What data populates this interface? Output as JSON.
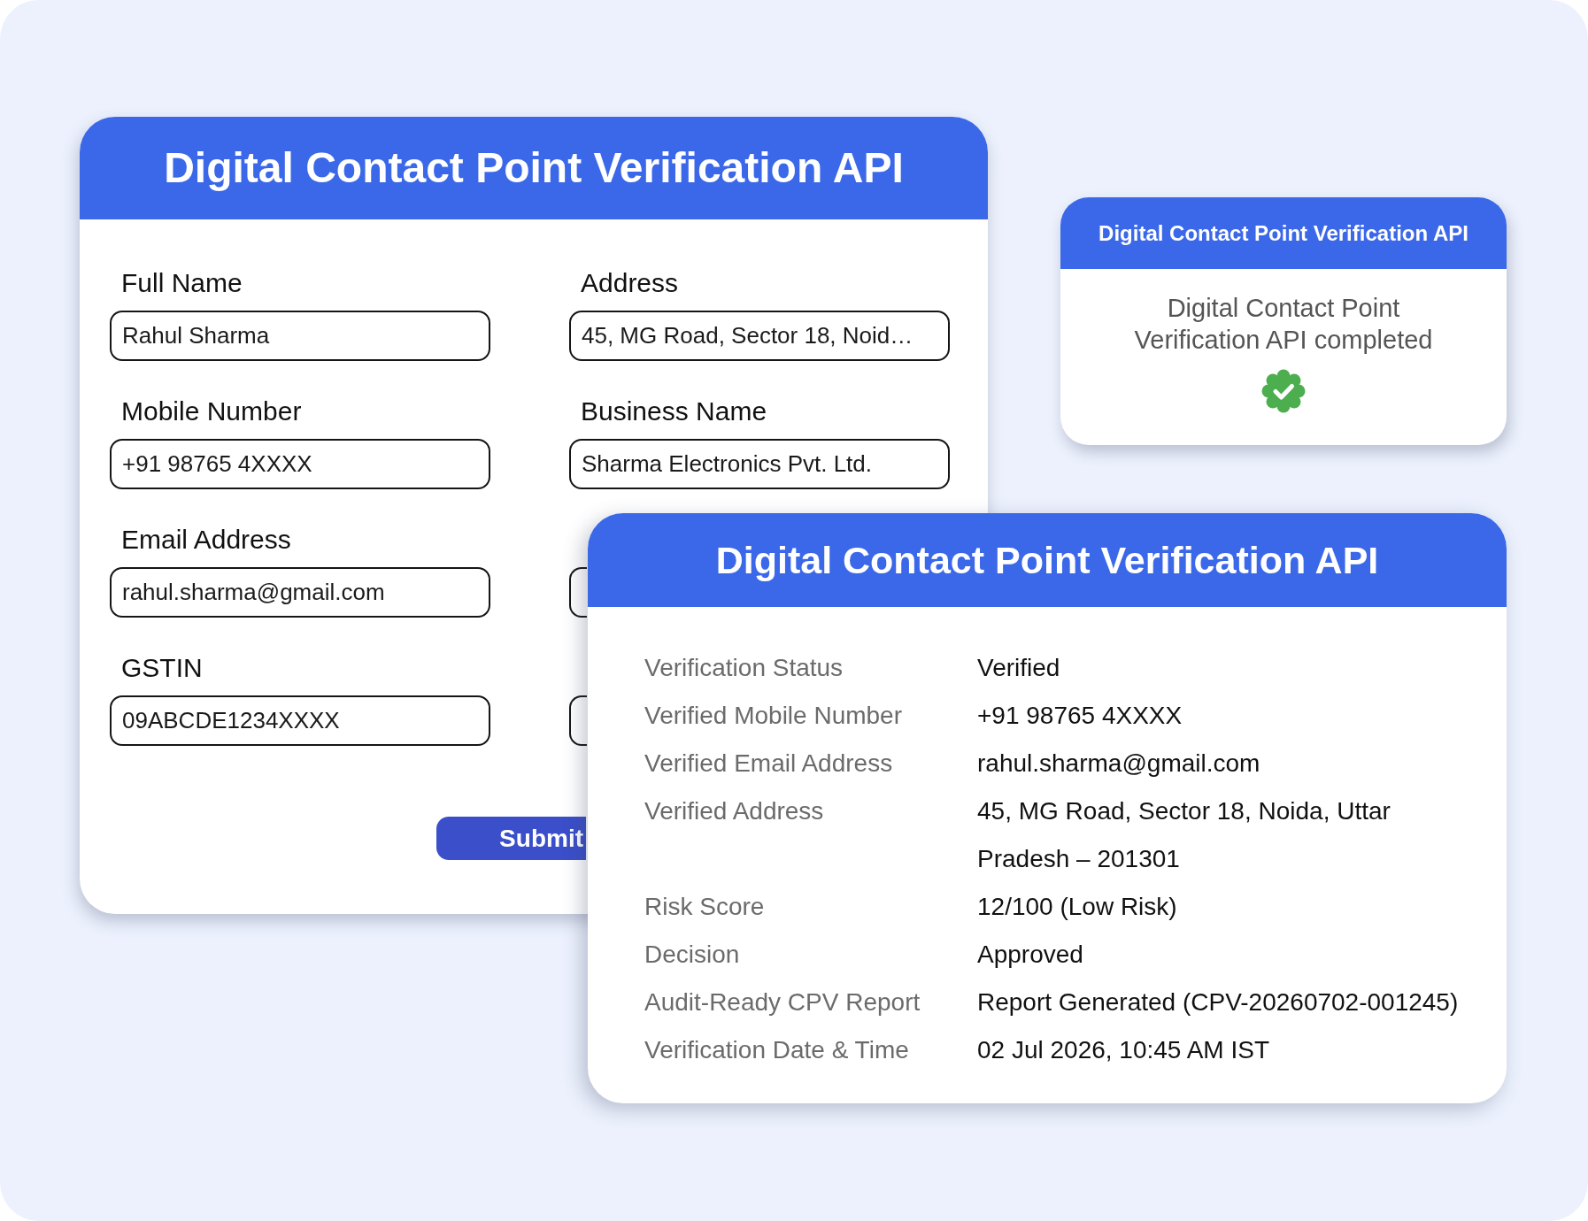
{
  "form_card": {
    "title": "Digital Contact Point Verification API",
    "fields": [
      {
        "kind": "filled",
        "label": "Full Name",
        "value": "Rahul Sharma"
      },
      {
        "kind": "filled",
        "label": "Address",
        "value": "45, MG Road, Sector 18, Noid…"
      },
      {
        "kind": "filled",
        "label": "Mobile Number",
        "value": "+91 98765 4XXXX"
      },
      {
        "kind": "filled",
        "label": "Business Name",
        "value": "Sharma Electronics Pvt. Ltd."
      },
      {
        "kind": "filled",
        "label": "Email Address",
        "value": "rahul.sharma@gmail.com"
      },
      {
        "kind": "covered"
      },
      {
        "kind": "filled",
        "label": "GSTIN",
        "value": "09ABCDE1234XXXX"
      },
      {
        "kind": "covered"
      }
    ],
    "submit_button": "Submit"
  },
  "status_card": {
    "title": "Digital Contact Point Verification API",
    "message": "Digital Contact Point Verification API completed"
  },
  "result_card": {
    "title": "Digital Contact Point Verification API",
    "rows": [
      {
        "label": "Verification Status",
        "value": "Verified"
      },
      {
        "label": "Verified Mobile Number",
        "value": "+91 98765 4XXXX"
      },
      {
        "label": "Verified Email Address",
        "value": "rahul.sharma@gmail.com"
      },
      {
        "label": "Verified Address",
        "value": "45, MG Road, Sector 18, Noida, Uttar Pradesh – 201301"
      },
      {
        "label": "Risk Score",
        "value": "12/100 (Low Risk)"
      },
      {
        "label": "Decision",
        "value": "Approved"
      },
      {
        "label": "Audit-Ready CPV Report",
        "value": "Report Generated (CPV-20260702-001245)"
      },
      {
        "label": "Verification Date & Time",
        "value": "02 Jul 2026, 10:45 AM IST"
      }
    ]
  }
}
